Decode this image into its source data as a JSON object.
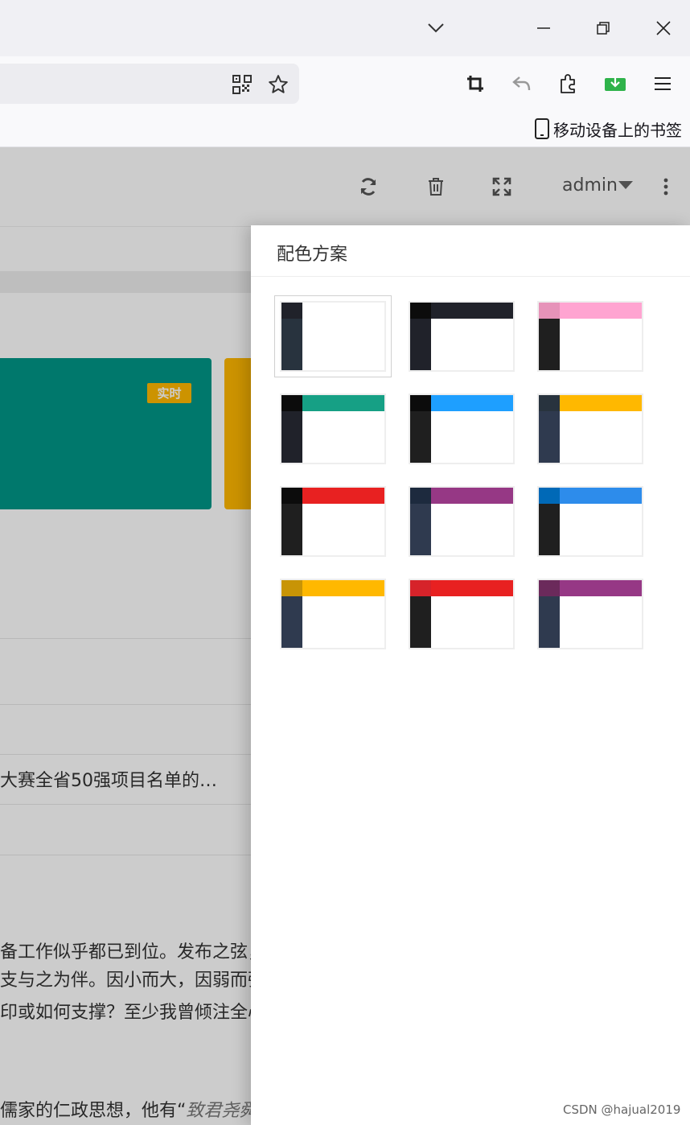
{
  "browser": {
    "bookmark_mobile": "移动设备上的书签"
  },
  "admin_header": {
    "username": "admin"
  },
  "background": {
    "badge": "实时",
    "list_item": "大赛全省50强项目名单的…",
    "para_line1": "备工作似乎都已到位。发布之弦，",
    "para_line2": "支与之为伴。因小而大，因弱而强",
    "para_line3": "印或如何支撑？至少我曾倾注全心",
    "para_line4_prefix": "儒家的仁政思想，他有“",
    "para_line4_em": "致君尧舜"
  },
  "panel": {
    "title": "配色方案",
    "schemes": [
      {
        "logo": "#20222a",
        "head": "#ffffff",
        "side": "#28333e",
        "selected": true
      },
      {
        "logo": "#0c0c0c",
        "head": "#20222a",
        "side": "#20222a",
        "selected": false
      },
      {
        "logo": "#e693b9",
        "head": "#ffa4d1",
        "side": "#1f1f1f",
        "selected": false
      },
      {
        "logo": "#0c0c0c",
        "head": "#16a085",
        "side": "#20222a",
        "selected": false
      },
      {
        "logo": "#0c0c0c",
        "head": "#1e9fff",
        "side": "#1f1f1f",
        "selected": false
      },
      {
        "logo": "#28333e",
        "head": "#ffb800",
        "side": "#2f3a4f",
        "selected": false
      },
      {
        "logo": "#0c0c0c",
        "head": "#e82121",
        "side": "#1f1f1f",
        "selected": false
      },
      {
        "logo": "#1d2a3e",
        "head": "#963885",
        "side": "#2f3a4f",
        "selected": false
      },
      {
        "logo": "#0069b7",
        "head": "#2d8ceb",
        "side": "#1f1f1f",
        "selected": false
      },
      {
        "logo": "#c89406",
        "head": "#ffb800",
        "side": "#2f3a4f",
        "selected": false
      },
      {
        "logo": "#d6232a",
        "head": "#e82121",
        "side": "#1f1f1f",
        "selected": false
      },
      {
        "logo": "#6b2a5b",
        "head": "#963885",
        "side": "#2f3a4f",
        "selected": false
      }
    ]
  },
  "watermark": "CSDN @hajual2019",
  "colors": {
    "teal": "#009688",
    "amber": "#ffb800"
  }
}
